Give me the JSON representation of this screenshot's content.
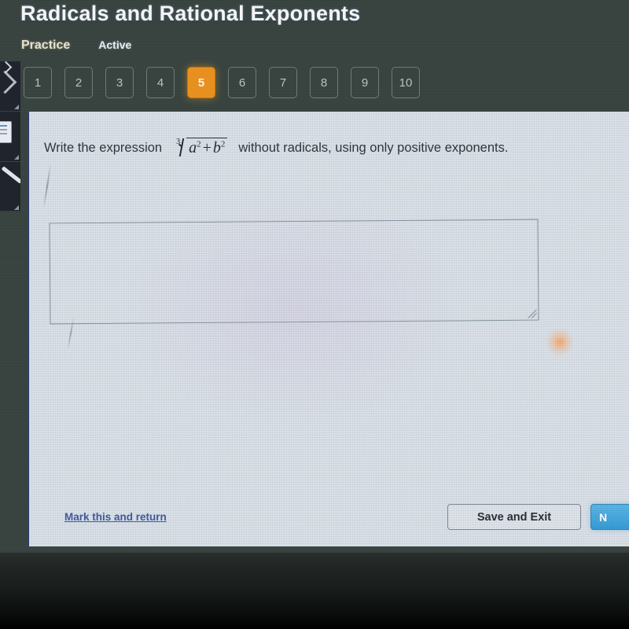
{
  "header": {
    "title": "Radicals and Rational Exponents",
    "mode_label": "Practice",
    "status_label": "Active"
  },
  "tabs": {
    "items": [
      {
        "label": "1",
        "current": false
      },
      {
        "label": "2",
        "current": false
      },
      {
        "label": "3",
        "current": false
      },
      {
        "label": "4",
        "current": false
      },
      {
        "label": "5",
        "current": true
      },
      {
        "label": "6",
        "current": false
      },
      {
        "label": "7",
        "current": false
      },
      {
        "label": "8",
        "current": false
      },
      {
        "label": "9",
        "current": false
      },
      {
        "label": "10",
        "current": false
      }
    ],
    "current_label": "5"
  },
  "question": {
    "text_before": "Write the expression",
    "text_after": "without radicals, using only positive exponents.",
    "expression": {
      "plain": "cube root of (a^2 + b^2)",
      "root_index": "3",
      "base_1": "a",
      "exp_1": "2",
      "operator": "+",
      "base_2": "b",
      "exp_2": "2"
    }
  },
  "answer": {
    "value": "",
    "placeholder": ""
  },
  "footer": {
    "mark_link_label": "Mark this and return",
    "save_button_label": "Save and Exit",
    "next_button_label": "N"
  },
  "colors": {
    "accent_orange": "#e8901f",
    "primary_blue": "#2593d2",
    "link_blue": "#2e4c96",
    "desktop": "#37433f",
    "panel": "#d7dee4"
  },
  "tool_strip": {
    "tools": [
      "cursor-arrow-icon",
      "card-icon",
      "line-tool-icon"
    ]
  }
}
